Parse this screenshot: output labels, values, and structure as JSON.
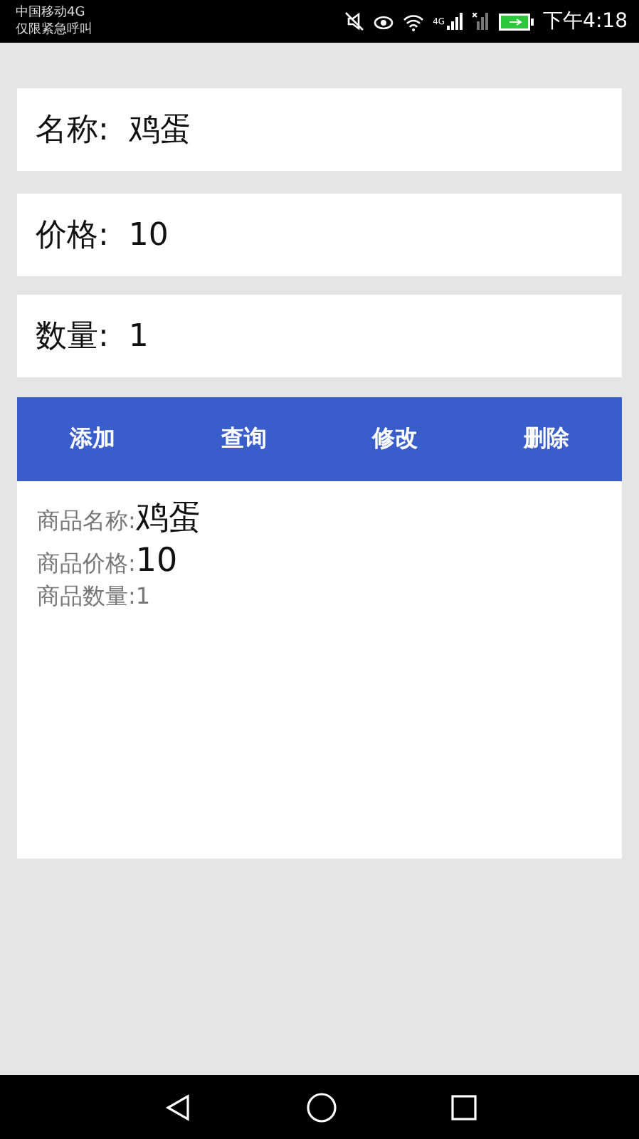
{
  "status_bar": {
    "carrier": "中国移动4G",
    "carrier_note": "仅限紧急呼叫",
    "signal_label": "4G",
    "time": "下午4:18"
  },
  "fields": [
    {
      "label": "名称:",
      "value": "鸡蛋"
    },
    {
      "label": "价格:",
      "value": "10"
    },
    {
      "label": "数量:",
      "value": "1"
    }
  ],
  "buttons": [
    "添加",
    "查询",
    "修改",
    "删除"
  ],
  "details": [
    {
      "label": "商品名称:",
      "value": "鸡蛋",
      "kind": "large"
    },
    {
      "label": "商品价格:",
      "value": "10",
      "kind": "large"
    },
    {
      "label": "商品数量:",
      "value": "1",
      "kind": "small"
    }
  ]
}
